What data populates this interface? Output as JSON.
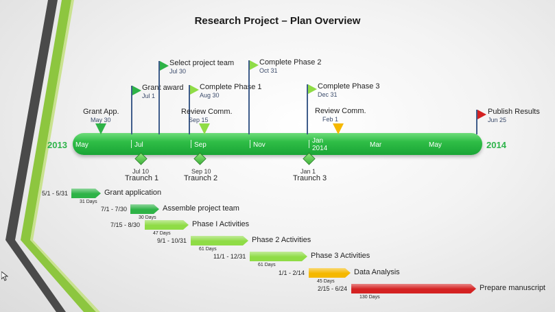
{
  "title": "Research Project – Plan Overview",
  "years": {
    "start": "2013",
    "end": "2014"
  },
  "months": [
    "May",
    "Jul",
    "Sep",
    "Nov",
    "Jan\n2014",
    "Mar",
    "May"
  ],
  "milestones": [
    {
      "label": "Grant App.",
      "date": "May 30",
      "kind": "triangle",
      "color": "#2eb347"
    },
    {
      "label": "Grant award",
      "date": "Jul 1",
      "kind": "flag",
      "color": "#2eb347"
    },
    {
      "label": "Select project team",
      "date": "Jul 30",
      "kind": "flag",
      "color": "#2eb347"
    },
    {
      "label": "Complete Phase 1",
      "date": "Aug 30",
      "kind": "flag",
      "color": "#8fdc46"
    },
    {
      "label": "Review Comm.",
      "date": "Sep 15",
      "kind": "triangle",
      "color": "#8fdc46"
    },
    {
      "label": "Complete Phase 2",
      "date": "Oct 31",
      "kind": "flag",
      "color": "#8fdc46"
    },
    {
      "label": "Complete Phase 3",
      "date": "Dec 31",
      "kind": "flag",
      "color": "#8fdc46"
    },
    {
      "label": "Review Comm.",
      "date": "Feb 1",
      "kind": "triangle",
      "color": "#f5b800"
    },
    {
      "label": "Publish Results",
      "date": "Jun 25",
      "kind": "flag",
      "color": "#d42222"
    }
  ],
  "traunches": [
    {
      "date": "Jul 10",
      "label": "Traunch 1"
    },
    {
      "date": "Sep 10",
      "label": "Traunch 2"
    },
    {
      "date": "Jan 1",
      "label": "Traunch 3"
    }
  ],
  "tasks": [
    {
      "range": "5/1 - 5/31",
      "name": "Grant application",
      "days": "31 Days",
      "color": "#2eb347"
    },
    {
      "range": "7/1 - 7/30",
      "name": "Assemble project team",
      "days": "30 Days",
      "color": "#2eb347"
    },
    {
      "range": "7/15 - 8/30",
      "name": "Phase I Activities",
      "days": "47 Days",
      "color": "#8fdc46"
    },
    {
      "range": "9/1 - 10/31",
      "name": "Phase 2 Activities",
      "days": "61 Days",
      "color": "#8fdc46"
    },
    {
      "range": "11/1 - 12/31",
      "name": "Phase 3 Activities",
      "days": "61 Days",
      "color": "#8fdc46"
    },
    {
      "range": "1/1 - 2/14",
      "name": "Data Analysis",
      "days": "45 Days",
      "color": "#f5b800"
    },
    {
      "range": "2/15 - 6/24",
      "name": "Prepare manuscript",
      "days": "130 Days",
      "color": "#d42222"
    }
  ]
}
